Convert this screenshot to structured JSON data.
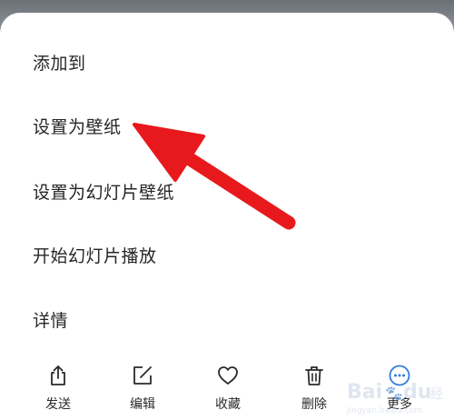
{
  "menu": {
    "items": [
      {
        "label": "添加到"
      },
      {
        "label": "设置为壁纸"
      },
      {
        "label": "设置为幻灯片壁纸"
      },
      {
        "label": "开始幻灯片播放"
      },
      {
        "label": "详情"
      }
    ]
  },
  "toolbar": {
    "share_label": "发送",
    "edit_label": "编辑",
    "favorite_label": "收藏",
    "delete_label": "删除",
    "more_label": "更多"
  },
  "icons": {
    "share": "share-icon",
    "edit": "edit-icon",
    "favorite": "heart-icon",
    "delete": "trash-icon",
    "more": "more-dots-icon"
  },
  "colors": {
    "annotation_arrow": "#e8191c",
    "more_accent": "#2f7dd8"
  }
}
